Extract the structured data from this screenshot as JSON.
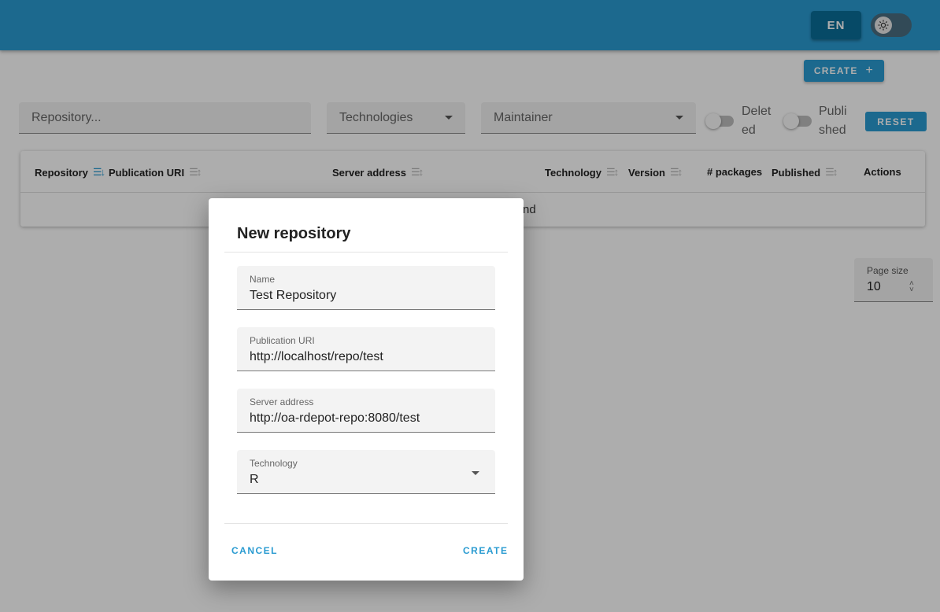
{
  "header": {
    "language": "EN",
    "theme_icon": "sun-icon"
  },
  "toolbar": {
    "create_label": "CREATE",
    "create_icon": "plus-icon"
  },
  "filters": {
    "repository_placeholder": "Repository...",
    "technologies_label": "Technologies",
    "maintainer_label": "Maintainer",
    "deleted_label": "Deleted",
    "published_label": "Published",
    "reset_label": "RESET"
  },
  "table": {
    "columns": [
      "Repository",
      "Publication URI",
      "Server address",
      "Technology",
      "Version",
      "# packages",
      "Published",
      "Actions"
    ],
    "empty_text": "nd"
  },
  "pagination": {
    "page_size_label": "Page size",
    "page_size_value": "10"
  },
  "dialog": {
    "title": "New repository",
    "fields": [
      {
        "label": "Name",
        "value": "Test Repository"
      },
      {
        "label": "Publication URI",
        "value": "http://localhost/repo/test"
      },
      {
        "label": "Server address",
        "value": "http://oa-rdepot-repo:8080/test"
      },
      {
        "label": "Technology",
        "value": "R"
      }
    ],
    "cancel_label": "CANCEL",
    "create_label": "CREATE"
  },
  "colors": {
    "primary": "#2a9bd1",
    "primary_dark": "#0a6d99",
    "overlay": "rgba(0,0,0,0.32)"
  }
}
